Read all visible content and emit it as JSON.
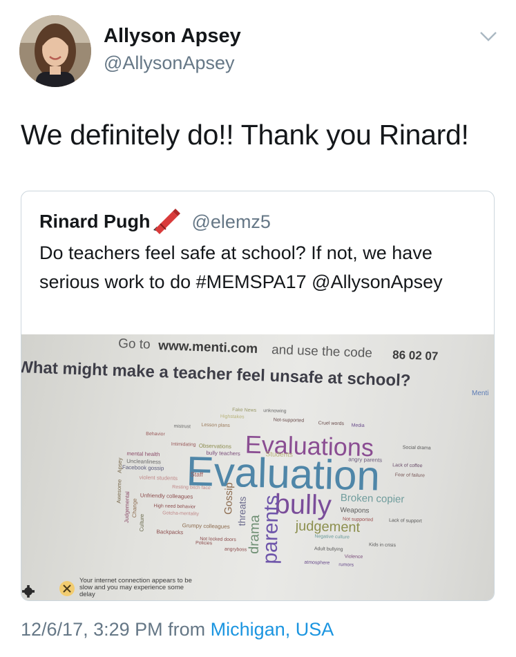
{
  "author": {
    "name": "Allyson Apsey",
    "handle": "@AllysonApsey",
    "avatar_icon": "profile-photo"
  },
  "tweet": {
    "text": "We definitely do!! Thank you Rinard!",
    "timestamp": "12/6/17, 3:29 PM",
    "from_label": "from",
    "location": "Michigan, USA"
  },
  "quoted": {
    "name": "Rinard Pugh",
    "name_emoji": "crayon-icon",
    "handle": "@elemz5",
    "text": "Do teachers feel safe at school? If not, we have serious work to do #MEMSPA17 @AllysonApsey"
  },
  "photo": {
    "instruction_prefix": "Go to",
    "url": "www.menti.com",
    "instruction_suffix": "and use the code",
    "code": "86 02 07",
    "question": "What might make a teacher feel unsafe at school?",
    "brand": "Menti",
    "slow_notice": "Your internet connection appears to be slow and you may experience some delay",
    "words": [
      "Evaluations",
      "Evaluation",
      "bully",
      "parents",
      "drama",
      "judgement",
      "Broken copier",
      "Gossip",
      "threats",
      "Weapons",
      "Students",
      "Staff",
      "Backpacks",
      "Grumpy colleagues",
      "Unfriendly colleagues",
      "Facebook gossip",
      "Uncleanliness",
      "mental health",
      "violent students",
      "Lesson plans",
      "Behavior",
      "mistrust",
      "Intimidating",
      "Observations",
      "bully teachers",
      "angry parents",
      "Not locked doors",
      "Adult bullying",
      "Violence",
      "atmosphere",
      "rumors",
      "Culture",
      "Change",
      "Judgemental",
      "Awesome",
      "Apsey",
      "Policies",
      "angryboss",
      "Gotcha-mentality",
      "High need behavior",
      "Resting bitch face",
      "Not supported",
      "Lack of support",
      "Negative culture",
      "Kids in crisis",
      "Fear of failure",
      "Lack of coffee",
      "Social drama",
      "Fake News",
      "unknowing",
      "Highstakes",
      "Not-supported",
      "Cruel words",
      "Media"
    ]
  }
}
